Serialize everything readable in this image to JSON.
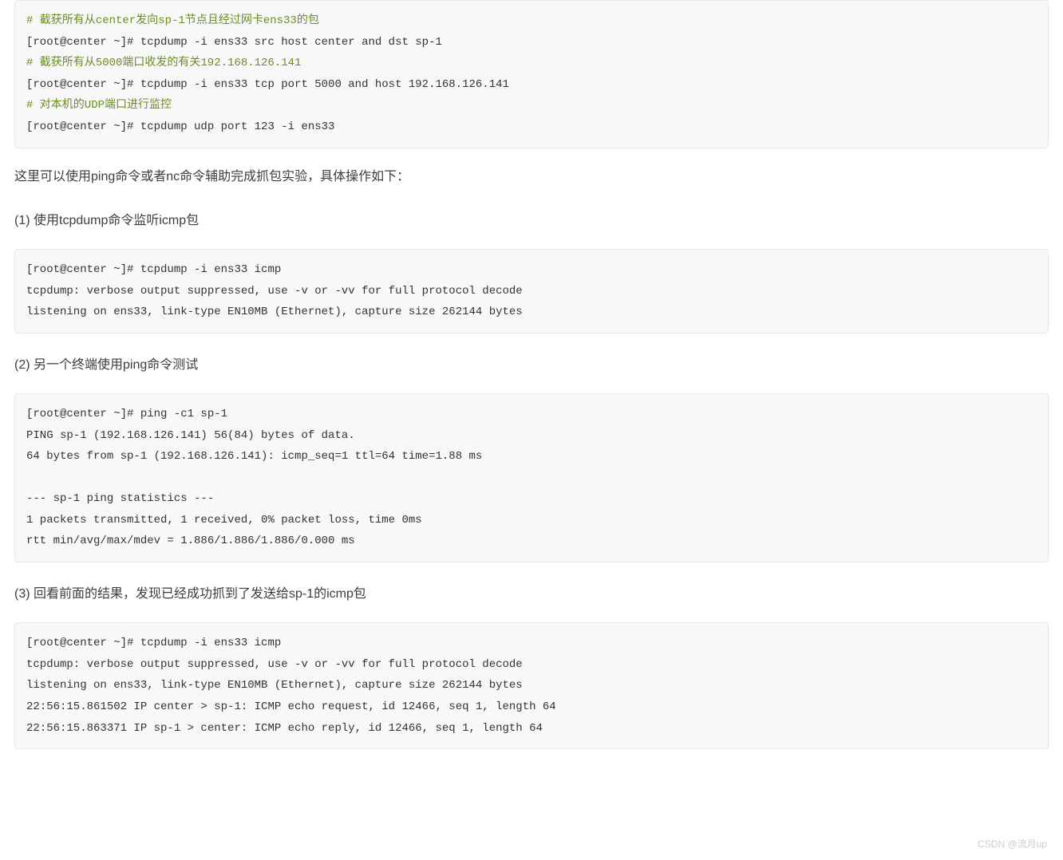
{
  "codeblock1": {
    "line1_comment": "# 截获所有从center发向sp-1节点且经过网卡ens33的包",
    "line2": "[root@center ~]# tcpdump -i ens33 src host center and dst sp-1",
    "line3_comment": "# 截获所有从5000端口收发的有关192.168.126.141",
    "line4": "[root@center ~]# tcpdump -i ens33 tcp port 5000 and host 192.168.126.141",
    "line5_comment": "# 对本机的UDP端口进行监控",
    "line6": "[root@center ~]# tcpdump udp port 123 -i ens33"
  },
  "paragraph1": "这里可以使用ping命令或者nc命令辅助完成抓包实验，具体操作如下：",
  "step1_heading": "(1) 使用tcpdump命令监听icmp包",
  "codeblock2": "[root@center ~]# tcpdump -i ens33 icmp\ntcpdump: verbose output suppressed, use -v or -vv for full protocol decode\nlistening on ens33, link-type EN10MB (Ethernet), capture size 262144 bytes\n",
  "step2_heading": "(2) 另一个终端使用ping命令测试",
  "codeblock3": "[root@center ~]# ping -c1 sp-1\nPING sp-1 (192.168.126.141) 56(84) bytes of data.\n64 bytes from sp-1 (192.168.126.141): icmp_seq=1 ttl=64 time=1.88 ms\n\n--- sp-1 ping statistics ---\n1 packets transmitted, 1 received, 0% packet loss, time 0ms\nrtt min/avg/max/mdev = 1.886/1.886/1.886/0.000 ms",
  "step3_heading": "(3) 回看前面的结果，发现已经成功抓到了发送给sp-1的icmp包",
  "codeblock4": "[root@center ~]# tcpdump -i ens33 icmp\ntcpdump: verbose output suppressed, use -v or -vv for full protocol decode\nlistening on ens33, link-type EN10MB (Ethernet), capture size 262144 bytes\n22:56:15.861502 IP center > sp-1: ICMP echo request, id 12466, seq 1, length 64\n22:56:15.863371 IP sp-1 > center: ICMP echo reply, id 12466, seq 1, length 64",
  "watermark": "CSDN @流月up"
}
